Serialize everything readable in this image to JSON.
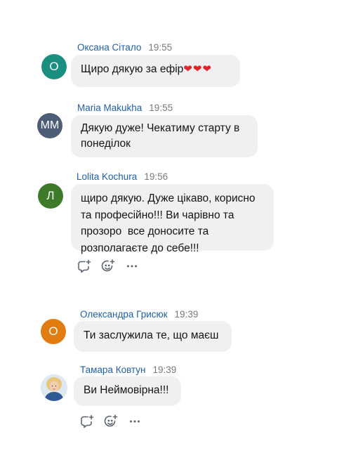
{
  "messages": [
    {
      "author": "Оксана Сітало",
      "time": "19:55",
      "text": "Щиро дякую за ефір",
      "hearts": "❤❤❤",
      "avatar_initials": "О",
      "avatar_color": "#1a8f80"
    },
    {
      "author": "Maria Makukha",
      "time": "19:55",
      "text_lines": [
        "Дякую дуже! Чекатиму старту в",
        "понеділок"
      ],
      "avatar_initials": "ММ",
      "avatar_color": "#4c5d75"
    },
    {
      "author": "Lolita Kochura",
      "time": "19:56",
      "text_lines": [
        "щиро дякую. Дуже цікаво, корисно",
        "та професійно!!! Ви чарівно та",
        "прозоро  все доносите та",
        "розполагаєте до себе!!!"
      ],
      "avatar_initials": "Л",
      "avatar_color": "#3d7a2a"
    },
    {
      "author": "Олександра Грисюк",
      "time": "19:39",
      "text": "Ти заслужила те, що маєш",
      "avatar_initials": "О",
      "avatar_color": "#e07c10"
    },
    {
      "author": "Тамара Ковтун",
      "time": "19:39",
      "text": "Ви Неймовірна!!!",
      "avatar_initials": ""
    }
  ],
  "icons": {
    "reply": "reply-plus-icon",
    "react": "emoji-add-icon",
    "more": "more-dots-icon"
  },
  "colors": {
    "author_link": "#1f5fa8",
    "bubble_bg": "#f0f0f3",
    "time": "#7a7a7a"
  }
}
